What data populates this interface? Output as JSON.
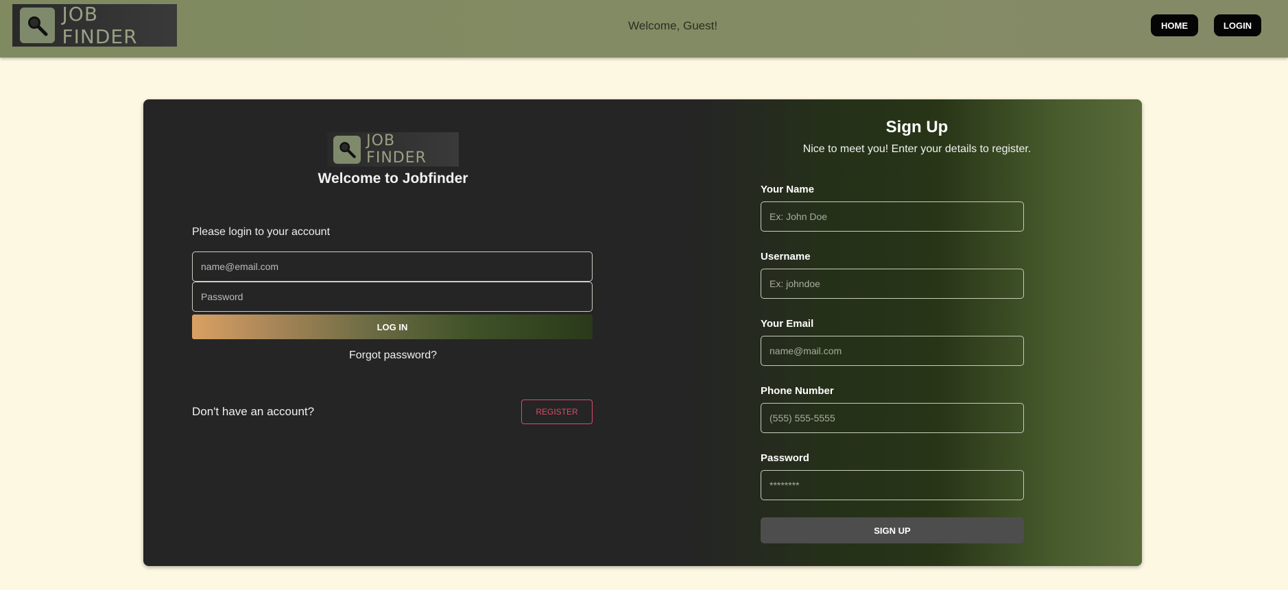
{
  "header": {
    "logo_text": "JOB FINDER",
    "welcome": "Welcome, Guest!",
    "nav": [
      {
        "label": "HOME"
      },
      {
        "label": "LOGIN"
      }
    ]
  },
  "login": {
    "logo_text": "JOB FINDER",
    "title": "Welcome to Jobfinder",
    "prompt": "Please login to your account",
    "email_placeholder": "name@email.com",
    "password_placeholder": "Password",
    "login_button": "LOG IN",
    "forgot": "Forgot password?",
    "no_account": "Don't have an account?",
    "register_button": "REGISTER"
  },
  "signup": {
    "title": "Sign Up",
    "subtitle": "Nice to meet you! Enter your details to register.",
    "fields": [
      {
        "label": "Your Name",
        "placeholder": "Ex: John Doe"
      },
      {
        "label": "Username",
        "placeholder": "Ex: johndoe"
      },
      {
        "label": "Your Email",
        "placeholder": "name@mail.com"
      },
      {
        "label": "Phone Number",
        "placeholder": "(555) 555-5555"
      },
      {
        "label": "Password",
        "placeholder": "********"
      }
    ],
    "button": "SIGN UP"
  },
  "colors": {
    "page_background": "#fdf8e2",
    "header_background": "#7f8a60",
    "card_background": "#252525",
    "register_accent": "#e04a6a"
  }
}
